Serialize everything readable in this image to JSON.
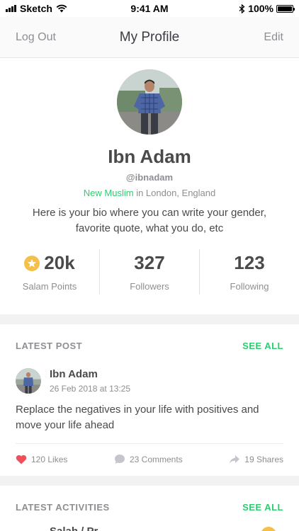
{
  "status_bar": {
    "carrier": "Sketch",
    "time": "9:41 AM",
    "battery": "100%"
  },
  "nav": {
    "left": "Log Out",
    "title": "My Profile",
    "right": "Edit"
  },
  "profile": {
    "name": "Ibn Adam",
    "handle": "@ibnadam",
    "badge": "New Muslim",
    "location": "in London, England",
    "bio": "Here is your bio where you can write your gender, favorite quote, what you do, etc",
    "stats": [
      {
        "value": "20k",
        "label": "Salam Points"
      },
      {
        "value": "327",
        "label": "Followers"
      },
      {
        "value": "123",
        "label": "Following"
      }
    ]
  },
  "latest_post": {
    "title": "LATEST POST",
    "see_all": "SEE ALL",
    "author": "Ibn Adam",
    "date": "26 Feb 2018 at 13:25",
    "text": "Replace the negatives in your life with positives and move your life ahead",
    "likes": "120 Likes",
    "comments": "23 Comments",
    "shares": "19 Shares"
  },
  "latest_activities": {
    "title": "LATEST ACTIVITIES",
    "see_all": "SEE ALL",
    "first_item_name": "Salah / Pr..."
  },
  "colors": {
    "accent": "#2ecc71",
    "star": "#f5c04a",
    "like": "#f0505a"
  }
}
